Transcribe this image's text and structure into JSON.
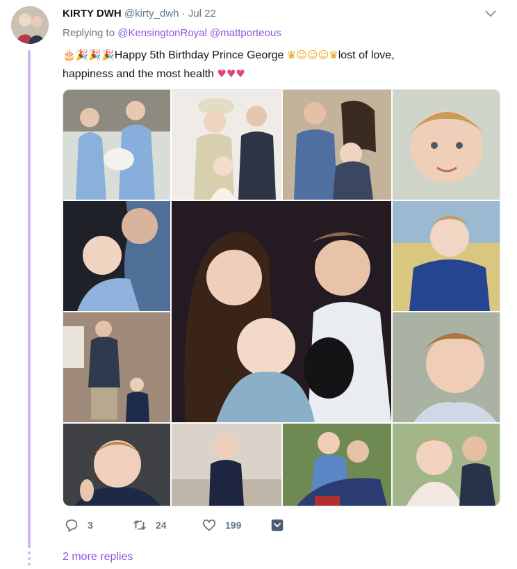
{
  "tweet": {
    "author_name": "KIRTY DWH",
    "handle": "@kirty_dwh",
    "separator": "·",
    "date": "Jul 22",
    "replying_label": "Replying to",
    "mentions": [
      "@KensingtonRoyal",
      "@mattporteous"
    ],
    "text_line1": "Happy 5th Birthday Prince George",
    "text_line1b": "lost of love,",
    "text_line2": "happiness and the most health"
  },
  "emoji": {
    "cake": "🎂",
    "popper": "🎉",
    "crown": "♛",
    "smile": "☺",
    "heart": "♥"
  },
  "actions": {
    "reply_count": "3",
    "retweet_count": "24",
    "like_count": "199"
  },
  "footer": {
    "more_replies": "2 more replies"
  },
  "icons": [
    "chevron-down-icon",
    "reply-icon",
    "retweet-icon",
    "like-icon",
    "dm-icon"
  ],
  "colors": {
    "accent": "#8e53e3",
    "thread": "#cfb8f0",
    "muted": "#657786"
  }
}
